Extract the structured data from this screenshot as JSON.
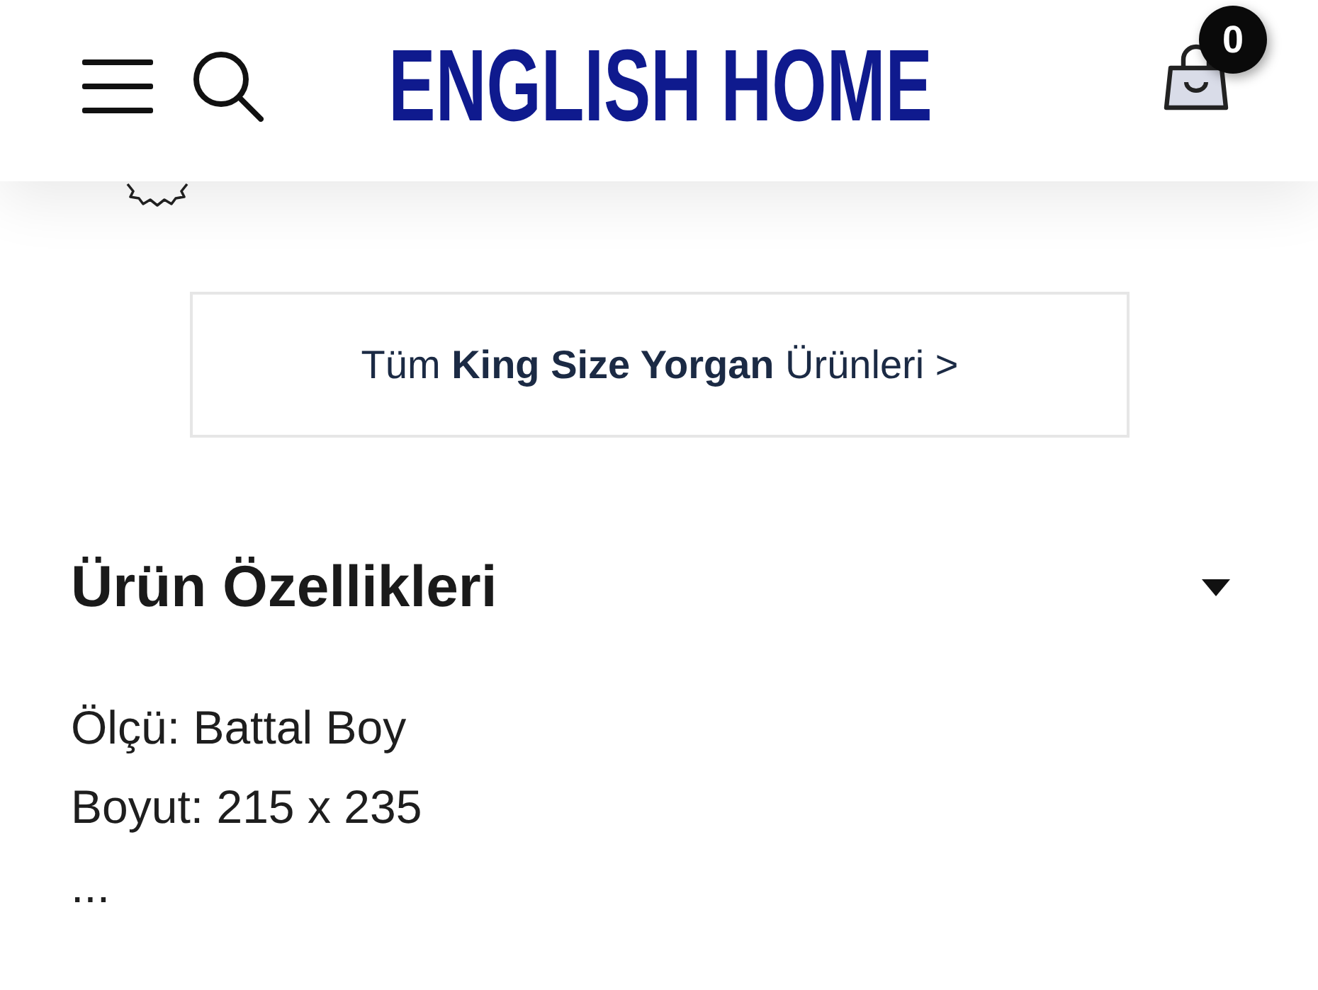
{
  "header": {
    "logo": "ENGLISH HOME",
    "cart_count": "0"
  },
  "category_link": {
    "text": "Tüm **King Size Yorgan** Ürünleri >"
  },
  "product_features": {
    "title": "Ürün Özellikleri",
    "expanded": true,
    "lines": [
      "Ölçü: Battal Boy",
      "Boyut: 215 x 235",
      "..."
    ]
  }
}
